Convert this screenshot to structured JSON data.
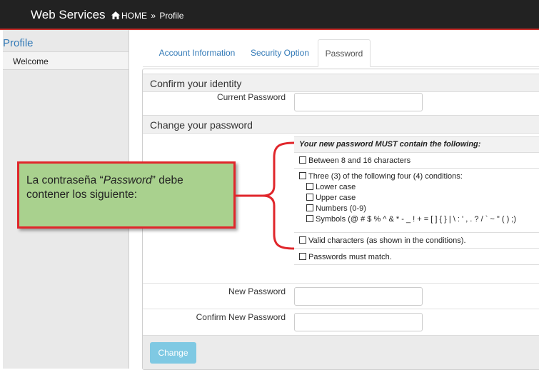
{
  "header": {
    "brand": "Web Services",
    "breadcrumb_home": "HOME",
    "breadcrumb_sep": "»",
    "breadcrumb_current": "Profile"
  },
  "sidebar": {
    "title": "Profile",
    "items": [
      {
        "label": "Welcome"
      }
    ]
  },
  "tabs": [
    {
      "label": "Account Information",
      "active": false
    },
    {
      "label": "Security Option",
      "active": false
    },
    {
      "label": "Password",
      "active": true
    }
  ],
  "form": {
    "identity_heading": "Confirm your identity",
    "current_password_label": "Current Password",
    "current_password_value": "",
    "change_heading": "Change your password",
    "new_password_label": "New Password",
    "new_password_value": "",
    "confirm_password_label": "Confirm New Password",
    "confirm_password_value": "",
    "change_button": "Change"
  },
  "requirements": {
    "heading": "Your new password MUST contain the following:",
    "length": "Between 8 and 16 characters",
    "three_of_four": "Three (3) of the following four (4) conditions:",
    "lower": "Lower case",
    "upper": "Upper case",
    "numbers": "Numbers (0-9)",
    "symbols": "Symbols (@ # $ % ^ & * - _ ! + = [ ] { } | \\ : ' , . ? / ` ~ \" ( ) ;)",
    "valid_chars": "Valid characters (as shown in the conditions).",
    "match": "Passwords must match."
  },
  "annotation": {
    "text_before": "La contraseña “",
    "text_italic": "Password",
    "text_after": "” debe contener los siguiente:",
    "border_color": "#e0262b",
    "fill_color": "#a9d18e"
  },
  "colors": {
    "topbar": "#222222",
    "accent_line": "#c9302c",
    "link": "#337ab7",
    "button": "#7fc9e3"
  }
}
